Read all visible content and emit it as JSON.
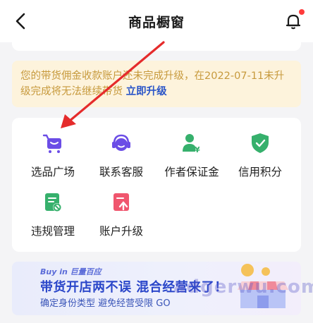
{
  "header": {
    "title": "商品橱窗",
    "back_icon": "chevron-left-icon",
    "bell_icon": "bell-icon"
  },
  "notice": {
    "text": "您的带货佣金收款账户还未完成升级，在2022-07-11未升级完成将无法继续带货",
    "link": "立即升级"
  },
  "tools": [
    {
      "label": "选品广场",
      "icon": "cart-icon",
      "color": "#6b4de6"
    },
    {
      "label": "联系客服",
      "icon": "headset-icon",
      "color": "#6b4de6"
    },
    {
      "label": "作者保证金",
      "icon": "deposit-icon",
      "color": "#36b06c"
    },
    {
      "label": "信用积分",
      "icon": "shield-check-icon",
      "color": "#36b06c"
    },
    {
      "label": "违规管理",
      "icon": "violation-icon",
      "color": "#36b06c"
    },
    {
      "label": "账户升级",
      "icon": "upgrade-icon",
      "color": "#f0566e"
    }
  ],
  "banner": {
    "brand": "Buy in 巨量百应",
    "headline": "带货开店两不误 混合经营来了！",
    "subtitle": "确定身份类型 避免经营受限 GO"
  },
  "watermark": "adgerwu.com",
  "colors": {
    "accent_purple": "#6b4de6",
    "green": "#36b06c",
    "pink": "#f0566e",
    "link_blue": "#2a55c8",
    "notice_bg": "#fdf3dc",
    "notice_text": "#c79a3d"
  }
}
